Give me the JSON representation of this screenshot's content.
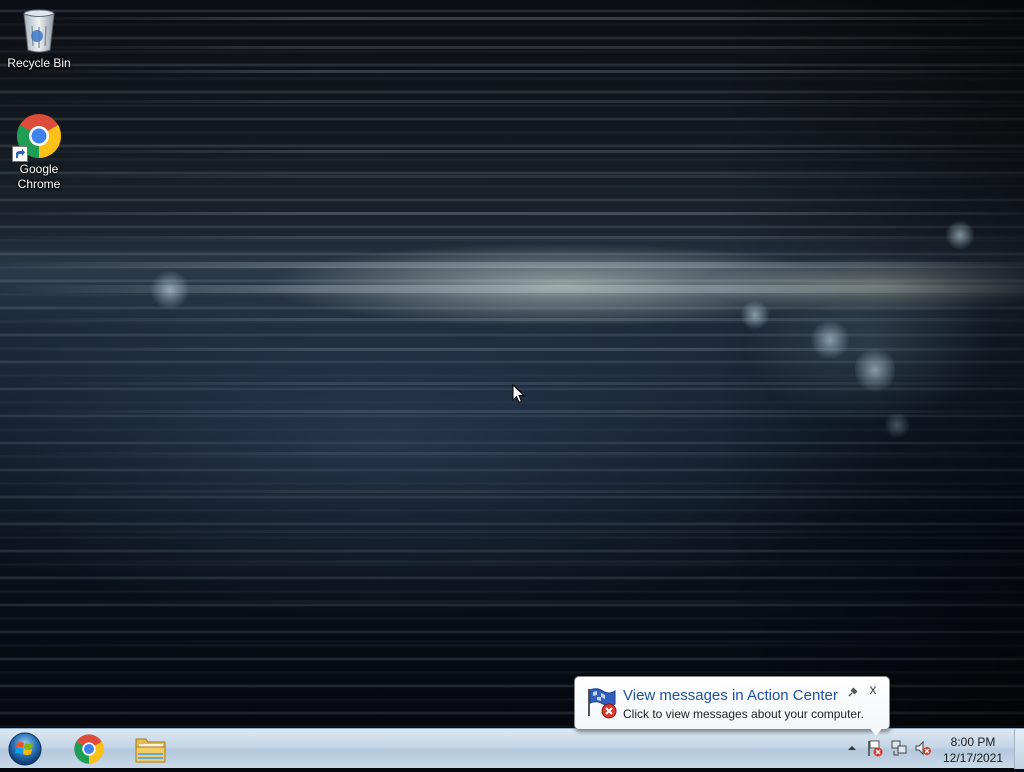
{
  "desktop": {
    "icons": [
      {
        "label": "Recycle Bin",
        "icon": "recycle-bin-icon"
      },
      {
        "label": "Google\nChrome",
        "label_line1": "Google",
        "label_line2": "Chrome",
        "icon": "chrome-icon"
      }
    ]
  },
  "taskbar": {
    "start_icon": "windows-start-icon",
    "pinned": [
      {
        "name": "Google Chrome",
        "icon": "chrome-icon"
      },
      {
        "name": "Windows Explorer",
        "icon": "folder-icon"
      }
    ],
    "tray": {
      "icons": [
        "show-hidden-icons-arrow",
        "action-center-flag-icon",
        "network-icon",
        "volume-muted-icon"
      ],
      "time": "8:00 PM",
      "date": "12/17/2021"
    }
  },
  "notification": {
    "title": "View messages in Action Center",
    "body": "Click to view messages about your computer.",
    "close_glyph": "x"
  },
  "colors": {
    "taskbar": "#c5d6e6",
    "balloon_title": "#1e51a4"
  }
}
